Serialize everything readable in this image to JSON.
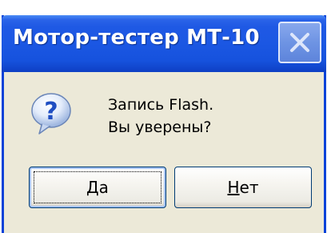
{
  "window": {
    "title": "Мотор-тестер МТ-10",
    "close_icon": "close-icon"
  },
  "dialog": {
    "icon": "question-icon",
    "message_line1": "Запись Flash.",
    "message_line2": "Вы уверены?"
  },
  "buttons": {
    "yes_mnemonic": "Д",
    "yes_rest": "а",
    "no_mnemonic": "Н",
    "no_rest": "ет"
  },
  "colors": {
    "titlebar": "#1b57e3",
    "dialog_bg": "#ece9d8",
    "button_border": "#003c74"
  }
}
